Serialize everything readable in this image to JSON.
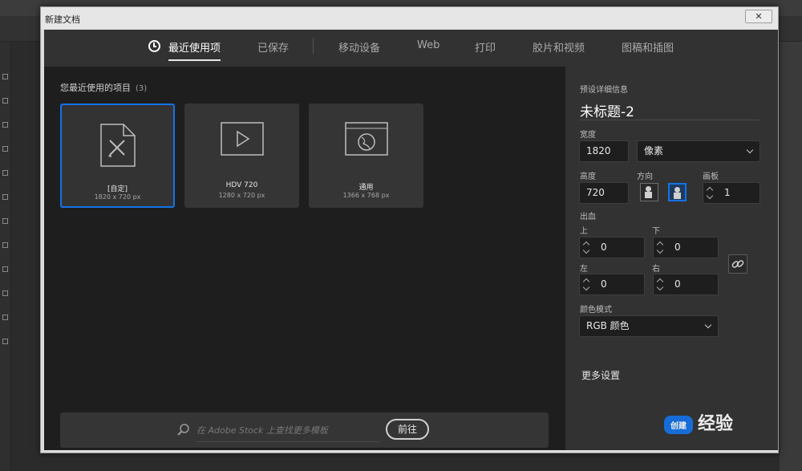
{
  "dialog": {
    "title": "新建文档",
    "close_label": "✕"
  },
  "tabs": {
    "recent": "最近使用项",
    "saved": "已保存",
    "mobile": "移动设备",
    "web": "Web",
    "print": "打印",
    "film": "胶片和视频",
    "art": "图稿和插图"
  },
  "recent": {
    "heading": "您最近使用的项目",
    "count": "(3)",
    "items": [
      {
        "name": "[自定]",
        "size": "1820 x 720 px",
        "icon": "custom-doc-icon"
      },
      {
        "name": "HDV 720",
        "size": "1280 x 720 px",
        "icon": "video-play-icon"
      },
      {
        "name": "通用",
        "size": "1366 x 768 px",
        "icon": "web-globe-icon"
      }
    ]
  },
  "search": {
    "placeholder": "在 Adobe Stock 上查找更多模板",
    "go_label": "前往"
  },
  "preset": {
    "section_label": "预设详细信息",
    "doc_name": "未标题-2",
    "width_label": "宽度",
    "width_value": "1820",
    "unit_value": "像素",
    "height_label": "高度",
    "height_value": "720",
    "orientation_label": "方向",
    "artboards_label": "画板",
    "artboards_value": "1",
    "bleed_label": "出血",
    "top_label": "上",
    "top_value": "0",
    "bottom_label": "下",
    "bottom_value": "0",
    "left_label": "左",
    "left_value": "0",
    "right_label": "右",
    "right_value": "0",
    "color_mode_label": "颜色模式",
    "color_mode_value": "RGB 颜色",
    "more_settings": "更多设置"
  },
  "watermark": {
    "badge": "创建",
    "text": "经验"
  },
  "colors": {
    "accent": "#1473e6",
    "panel_dark": "#1e1e1e",
    "panel": "#323232"
  }
}
